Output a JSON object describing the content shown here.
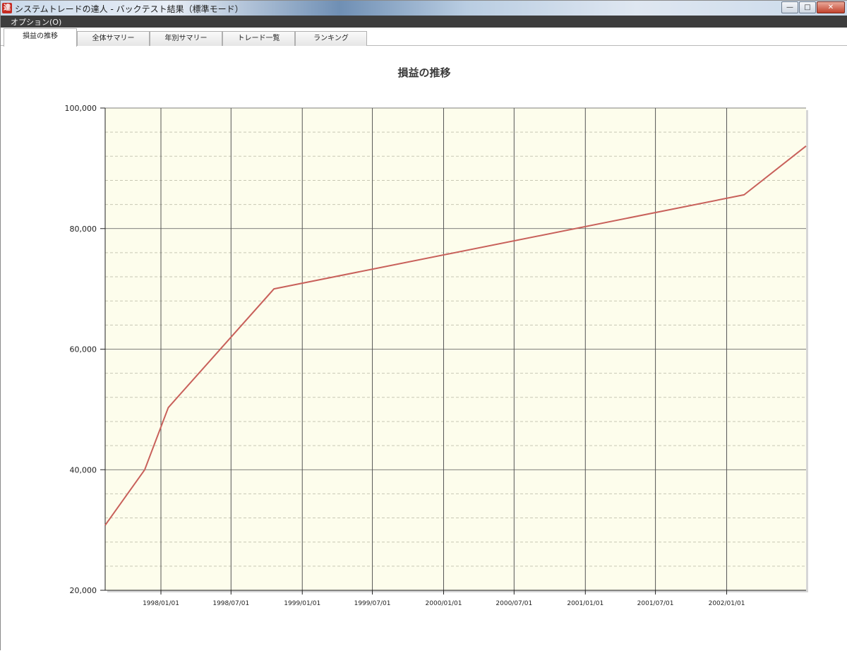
{
  "window": {
    "title": "システムトレードの達人 - バックテスト結果（標準モード）",
    "icon": "app-logo-icon",
    "controls": {
      "minimize": "—",
      "maximize": "□",
      "close": "✕"
    }
  },
  "menu": {
    "items": [
      {
        "label": "オプション(O)"
      }
    ]
  },
  "tabs": [
    {
      "label": "損益の推移",
      "active": true
    },
    {
      "label": "全体サマリー",
      "active": false
    },
    {
      "label": "年別サマリー",
      "active": false
    },
    {
      "label": "トレード一覧",
      "active": false
    },
    {
      "label": "ランキング",
      "active": false
    }
  ],
  "colors": {
    "plot_background": "#fdfdec",
    "line": "#c8605a",
    "grid_major": "#555555",
    "grid_minor": "#c8c8b4"
  },
  "chart_data": {
    "type": "line",
    "title": "損益の推移",
    "xlabel": "",
    "ylabel": "",
    "ylim": [
      20000,
      100000
    ],
    "xlim": [
      "1997-08-10",
      "2002-07-25"
    ],
    "y_ticks": [
      "20,000",
      "40,000",
      "60,000",
      "80,000",
      "100,000"
    ],
    "x_ticks": [
      "1998/01/01",
      "1998/07/01",
      "1999/01/01",
      "1999/07/01",
      "2000/01/01",
      "2000/07/01",
      "2001/01/01",
      "2001/07/01",
      "2002/01/01"
    ],
    "grid": true,
    "series": [
      {
        "x": [
          "1997-08-10",
          "1997-11-20",
          "1998-01-20",
          "1998-10-20",
          "2002-02-15",
          "2002-07-25"
        ],
        "y": [
          30800,
          40000,
          50300,
          70000,
          85600,
          93700
        ]
      }
    ]
  }
}
